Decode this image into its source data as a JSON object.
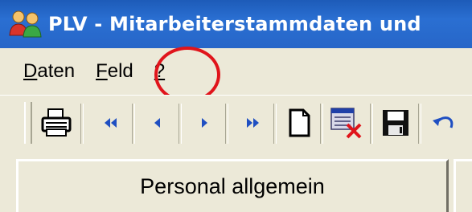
{
  "window": {
    "title": "PLV - Mitarbeiterstammdaten und",
    "app_icon": "people-icon"
  },
  "menu": {
    "items": [
      {
        "key": "D",
        "rest": "aten"
      },
      {
        "key": "F",
        "rest": "eld"
      },
      {
        "key": "?",
        "rest": ""
      }
    ]
  },
  "toolbar": {
    "buttons": [
      "print-icon",
      "first-record-icon",
      "previous-record-icon",
      "next-record-icon",
      "last-record-icon",
      "new-record-icon",
      "delete-record-icon",
      "save-icon",
      "undo-icon"
    ]
  },
  "tabs": {
    "active_label": "Personal allgemein"
  },
  "annotation": {
    "color": "#e0141b",
    "target": "help-menu"
  }
}
